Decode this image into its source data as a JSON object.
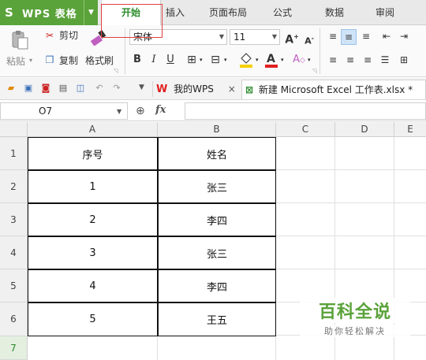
{
  "app": {
    "logo": "S",
    "title": "WPS 表格"
  },
  "tabs": [
    "开始",
    "插入",
    "页面布局",
    "公式",
    "数据",
    "审阅"
  ],
  "ribbon": {
    "paste": "粘贴",
    "cut": "剪切",
    "copy": "复制",
    "format_painter": "格式刷",
    "font_name": "宋体",
    "font_size": "11",
    "bold": "B",
    "italic": "I",
    "underline": "U"
  },
  "quick_bar": {
    "doc_tabs": [
      "我的WPS",
      "新建 Microsoft Excel 工作表.xlsx *"
    ],
    "close": "×"
  },
  "formula_bar": {
    "name_box": "O7",
    "fx": "fx",
    "value": ""
  },
  "columns": [
    "A",
    "B",
    "C",
    "D",
    "E"
  ],
  "rows": [
    "1",
    "2",
    "3",
    "4",
    "5",
    "6",
    "7"
  ],
  "table": [
    [
      "序号",
      "姓名"
    ],
    [
      "1",
      "张三"
    ],
    [
      "2",
      "李四"
    ],
    [
      "3",
      "张三"
    ],
    [
      "4",
      "李四"
    ],
    [
      "5",
      "王五"
    ]
  ],
  "watermark": {
    "title": "百科全说",
    "subtitle": "助你轻松解决"
  },
  "colors": {
    "accent": "#5aa23a",
    "active_tab_text": "#2b8a2b",
    "highlight": "#e04040"
  }
}
